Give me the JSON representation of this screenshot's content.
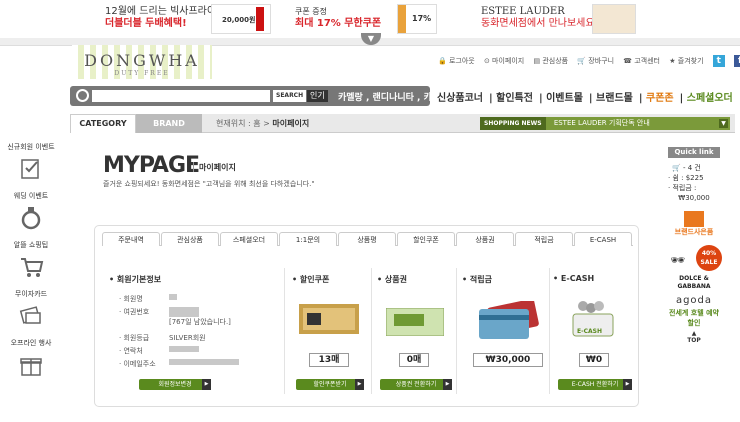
{
  "banner": {
    "ad1": {
      "line1": "12월에 드리는 빅사프라이즈",
      "line2": "더블더블 두배혜택!",
      "price": "20,000원"
    },
    "ad2": {
      "line1": "쿠폰 증정",
      "line2": "최대 17% 무한쿠폰",
      "badge": "17%"
    },
    "ad3": {
      "line1": "ESTEE LAUDER",
      "line2": "동화면세점에서 만나보세요."
    }
  },
  "header": {
    "logo_main": "DONGWHA",
    "logo_sub": "DUTY FREE",
    "top_links": [
      "로그아웃",
      "마이페이지",
      "관심상품",
      "장바구니",
      "고객센터",
      "즐겨찾기"
    ],
    "social": [
      "t",
      "f"
    ]
  },
  "search": {
    "placeholder": "",
    "button_label": "SEARCH",
    "popular_label": "인기",
    "keywords": "카멜랑 , 랜디나니타 , 카멜 , 입생로랑"
  },
  "main_nav": [
    {
      "label": "신상품코너",
      "color": "#333333"
    },
    {
      "label": "할인특전",
      "color": "#333333"
    },
    {
      "label": "이벤트몰",
      "color": "#333333"
    },
    {
      "label": "브랜드몰",
      "color": "#333333"
    },
    {
      "label": "쿠폰존",
      "color": "#e07a12"
    },
    {
      "label": "스페셜오더",
      "color": "#5a8a1e"
    }
  ],
  "category_bar": {
    "tab_category": "CATEGORY",
    "tab_brand": "BRAND",
    "breadcrumb_prefix": "현재위치 : 홈 >",
    "breadcrumb_current": "마이페이지",
    "news_label": "SHOPPING NEWS",
    "news_text": "ESTEE LAUDER 기획단독 안내"
  },
  "left_sidebar": [
    {
      "label": "신규회원 이벤트",
      "icon": "checklist-icon"
    },
    {
      "label": "웨딩 이벤트",
      "icon": "ring-icon"
    },
    {
      "label": "알뜰 쇼핑팁",
      "icon": "cart-icon"
    },
    {
      "label": "무이자카드",
      "icon": "card-icon"
    },
    {
      "label": "오프라인 행사",
      "icon": "gift-icon"
    }
  ],
  "mypage": {
    "title": "MYPAGE",
    "subtitle": "마이페이지",
    "welcome": "즐거운 쇼핑되세요! 동화면세점은 \"고객님을 위해 최선을 다하겠습니다.\"",
    "tabs": [
      "주문내역",
      "관심상품",
      "스페셜오더",
      "1:1문의",
      "상품평",
      "할인쿠폰",
      "상품권",
      "적립금",
      "E-CASH"
    ],
    "member": {
      "title": "회원기본정보",
      "fields": [
        {
          "label": "회원명",
          "value": ""
        },
        {
          "label": "여권번호",
          "value": ""
        },
        {
          "label": "",
          "value": "[767일 남았습니다.]"
        },
        {
          "label": "회원등급",
          "value": "SILVER회원"
        },
        {
          "label": "연락처",
          "value": ""
        },
        {
          "label": "이메일주소",
          "value": ""
        }
      ],
      "button": "회원정보변경"
    },
    "coupon": {
      "title": "할인쿠폰",
      "value": "13매",
      "button": "할인쿠폰받기",
      "ticket_label": "쿠폰"
    },
    "giftcard": {
      "title": "상품권",
      "value": "0매",
      "button": "상품권 전환하기",
      "ticket_label": "상품권"
    },
    "points": {
      "title": "적립금",
      "value": "₩30,000"
    },
    "ecash": {
      "title": "E-CASH",
      "value": "₩0",
      "button": "E-CASH 전환하기",
      "badge": "E-CASH"
    }
  },
  "right_sidebar": {
    "quick_link": "Quick link",
    "cart": "4 건",
    "save_label": "· 쉼 :",
    "save_value": "$225",
    "points_label": "· 적립금 :",
    "points_value": "₩30,000",
    "brand_coupon": "브랜드사은품",
    "dg_sale": "40% SALE",
    "dg_brand": "DOLCE & GABBANA",
    "agoda": "agoda",
    "hotel": "전세계 호텔 예약할인",
    "top": "TOP"
  }
}
